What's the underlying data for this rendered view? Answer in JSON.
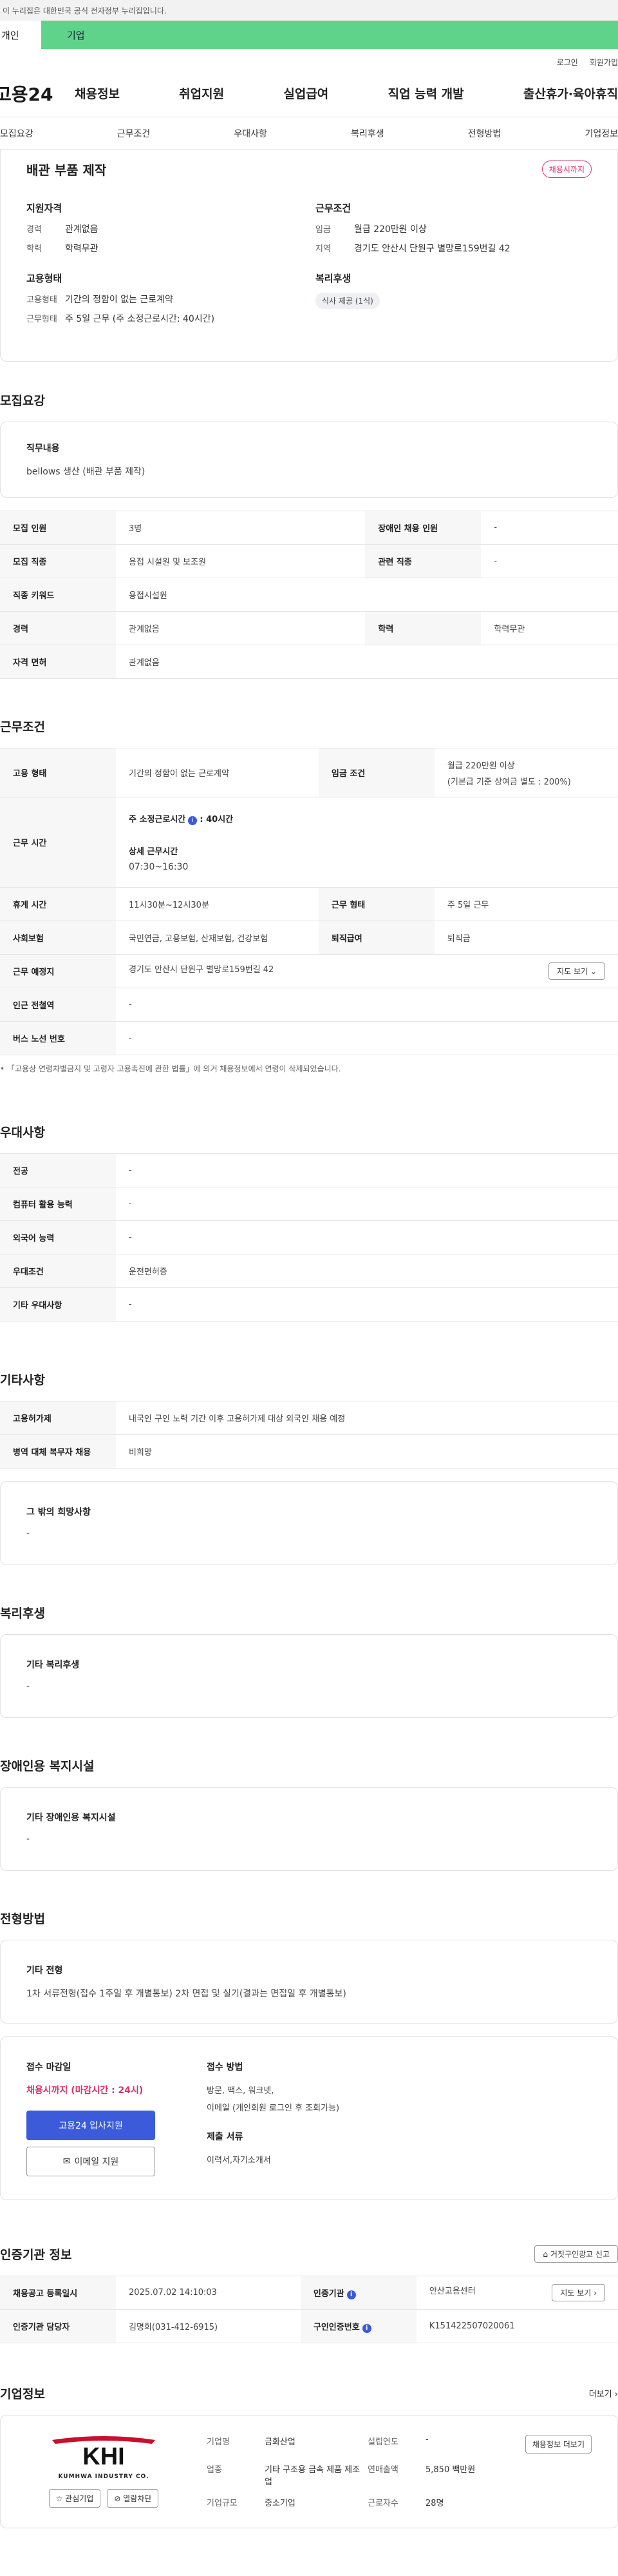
{
  "gov_banner": "이 누리집은 대한민국 공식 전자정부 누리집입니다.",
  "service_tabs": {
    "personal": "개인",
    "company": "기업"
  },
  "util": {
    "login": "로그인",
    "join": "회원가입"
  },
  "logo": "고용24",
  "gnb": [
    "채용정보",
    "취업지원",
    "실업급여",
    "직업 능력 개발",
    "출산휴가·육아휴직"
  ],
  "anchor_tabs": [
    "모집요강",
    "근무조건",
    "우대사항",
    "복리후생",
    "전형방법",
    "기업정보"
  ],
  "summary": {
    "title": "배관 부품 제작",
    "badge": "채용시까지",
    "qual_title": "지원자격",
    "qual_rows": [
      {
        "k": "경력",
        "v": "관계없음"
      },
      {
        "k": "학력",
        "v": "학력무관"
      }
    ],
    "cond_title": "근무조건",
    "cond_rows": [
      {
        "k": "임금",
        "v": "월급 220만원 이상"
      },
      {
        "k": "지역",
        "v": "경기도 안산시 단원구 별망로159번길 42"
      }
    ],
    "emp_title": "고용형태",
    "emp_rows": [
      {
        "k": "고용형태",
        "v": "기간의 정함이 없는 근로계약"
      },
      {
        "k": "근무형태",
        "v": "주 5일 근무 (주 소정근로시간: 40시간)"
      }
    ],
    "welfare_title": "복리후생",
    "welfare_chip": "식사 제공 (1식)"
  },
  "recruit": {
    "title": "모집요강",
    "duty_label": "직무내용",
    "duty_value": "bellows 생산 (배관 부품 제작)",
    "table": {
      "count_label": "모집 인원",
      "count_value": "3명",
      "disabled_label": "장애인 채용 인원",
      "disabled_value": "-",
      "job_label": "모집 직종",
      "job_value": "용접 시설원 및 보조원",
      "related_label": "관련 직종",
      "related_value": "-",
      "keyword_label": "직종 키워드",
      "keyword_value": "용접시설원",
      "career_label": "경력",
      "career_value": "관계없음",
      "edu_label": "학력",
      "edu_value": "학력무관",
      "license_label": "자격 면허",
      "license_value": "관계없음"
    }
  },
  "work": {
    "title": "근무조건",
    "emp_type_label": "고용 형태",
    "emp_type_value": "기간의 정함이 없는 근로계약",
    "wage_label": "임금 조건",
    "wage_value": "월급 220만원 이상",
    "wage_note": "(기본급 기준 상여금 별도 : 200%)",
    "hours_label": "근무 시간",
    "weekly_label": "주 소정근로시간",
    "weekly_value": ": 40시간",
    "detail_label": "상세 근무시간",
    "detail_value": "07:30~16:30",
    "break_label": "휴게 시간",
    "break_value": "11시30분~12시30분",
    "shift_label": "근무 형태",
    "shift_value": "주 5일 근무",
    "insurance_label": "사회보험",
    "insurance_value": "국민연금, 고용보험, 산재보험, 건강보험",
    "severance_label": "퇴직급여",
    "severance_value": "퇴직금",
    "place_label": "근무 예정지",
    "place_value": "경기도 안산시 단원구 별망로159번길 42",
    "map_btn": "지도 보기",
    "subway_label": "인근 전철역",
    "subway_value": "-",
    "bus_label": "버스 노선 번호",
    "bus_value": "-",
    "note": "「고용상 연령차별금지 및 고령자 고용촉진에 관한 법률」에 의거 채용정보에서 연령이 삭제되었습니다."
  },
  "pref": {
    "title": "우대사항",
    "rows": [
      {
        "k": "전공",
        "v": "-"
      },
      {
        "k": "컴퓨터 활용 능력",
        "v": "-"
      },
      {
        "k": "외국어 능력",
        "v": "-"
      },
      {
        "k": "우대조건",
        "v": "운전면허증"
      },
      {
        "k": "기타 우대사항",
        "v": "-"
      }
    ]
  },
  "etc": {
    "title": "기타사항",
    "foreign_label": "고용허가제",
    "foreign_value": "내국인 구인 노력 기간 이후 고용허가제 대상 외국인 채용 예정",
    "military_label": "병역 대체 복무자 채용",
    "military_value": "비희망",
    "other_label": "그 밖의 희망사항",
    "other_value": "-"
  },
  "welfare": {
    "title": "복리후생",
    "label": "기타 복리후생",
    "value": "-"
  },
  "disability": {
    "title": "장애인용 복지시설",
    "label": "기타 장애인용 복지시설",
    "value": "-"
  },
  "selection": {
    "title": "전형방법",
    "etc_label": "기타 전형",
    "etc_value": "1차 서류전형(접수 1주일 후 개별통보) 2차 면접 및 실기(결과는 면접일 후 개별통보)",
    "deadline_label": "접수 마감일",
    "deadline_value": "채용시까지 (마감시간 : 24시)",
    "apply_btn": "고용24 입사지원",
    "email_btn": "이메일 지원",
    "method_label": "접수 방법",
    "method_value1": "방문, 팩스, 워크넷,",
    "method_value2": "이메일 (개인회원 로그인 후 조회가능)",
    "docs_label": "제출 서류",
    "docs_value": "이력서,자기소개서"
  },
  "cert": {
    "title": "인증기관 정보",
    "report_btn": "거짓구인광고 신고",
    "reg_label": "채용공고 등록일시",
    "reg_value": "2025.07.02 14:10:03",
    "agency_label": "인증기관",
    "agency_value": "안산고용센터",
    "map_btn": "지도 보기",
    "manager_label": "인증기관 담당자",
    "manager_value": "김명희(031-412-6915)",
    "no_label": "구인인증번호",
    "no_value": "K151422507020061"
  },
  "company": {
    "title": "기업정보",
    "more": "더보기",
    "logo_text": "KHI",
    "logo_sub": "KUMHWA INDUSTRY CO.",
    "interest_btn": "관심기업",
    "block_btn": "열람차단",
    "name_label": "기업명",
    "name_value": "금화산업",
    "industry_label": "업종",
    "industry_value": "기타 구조용 금속 제품 제조업",
    "size_label": "기업규모",
    "size_value": "중소기업",
    "founded_label": "설립연도",
    "founded_value": "-",
    "sales_label": "연매출액",
    "sales_value": "5,850 백만원",
    "employees_label": "근로자수",
    "employees_value": "28명",
    "more_btn": "채용정보 더보기"
  },
  "colors": {
    "accent": "#3b5bdb",
    "brand_green": "#5fd389",
    "deadline": "#d5336a"
  }
}
